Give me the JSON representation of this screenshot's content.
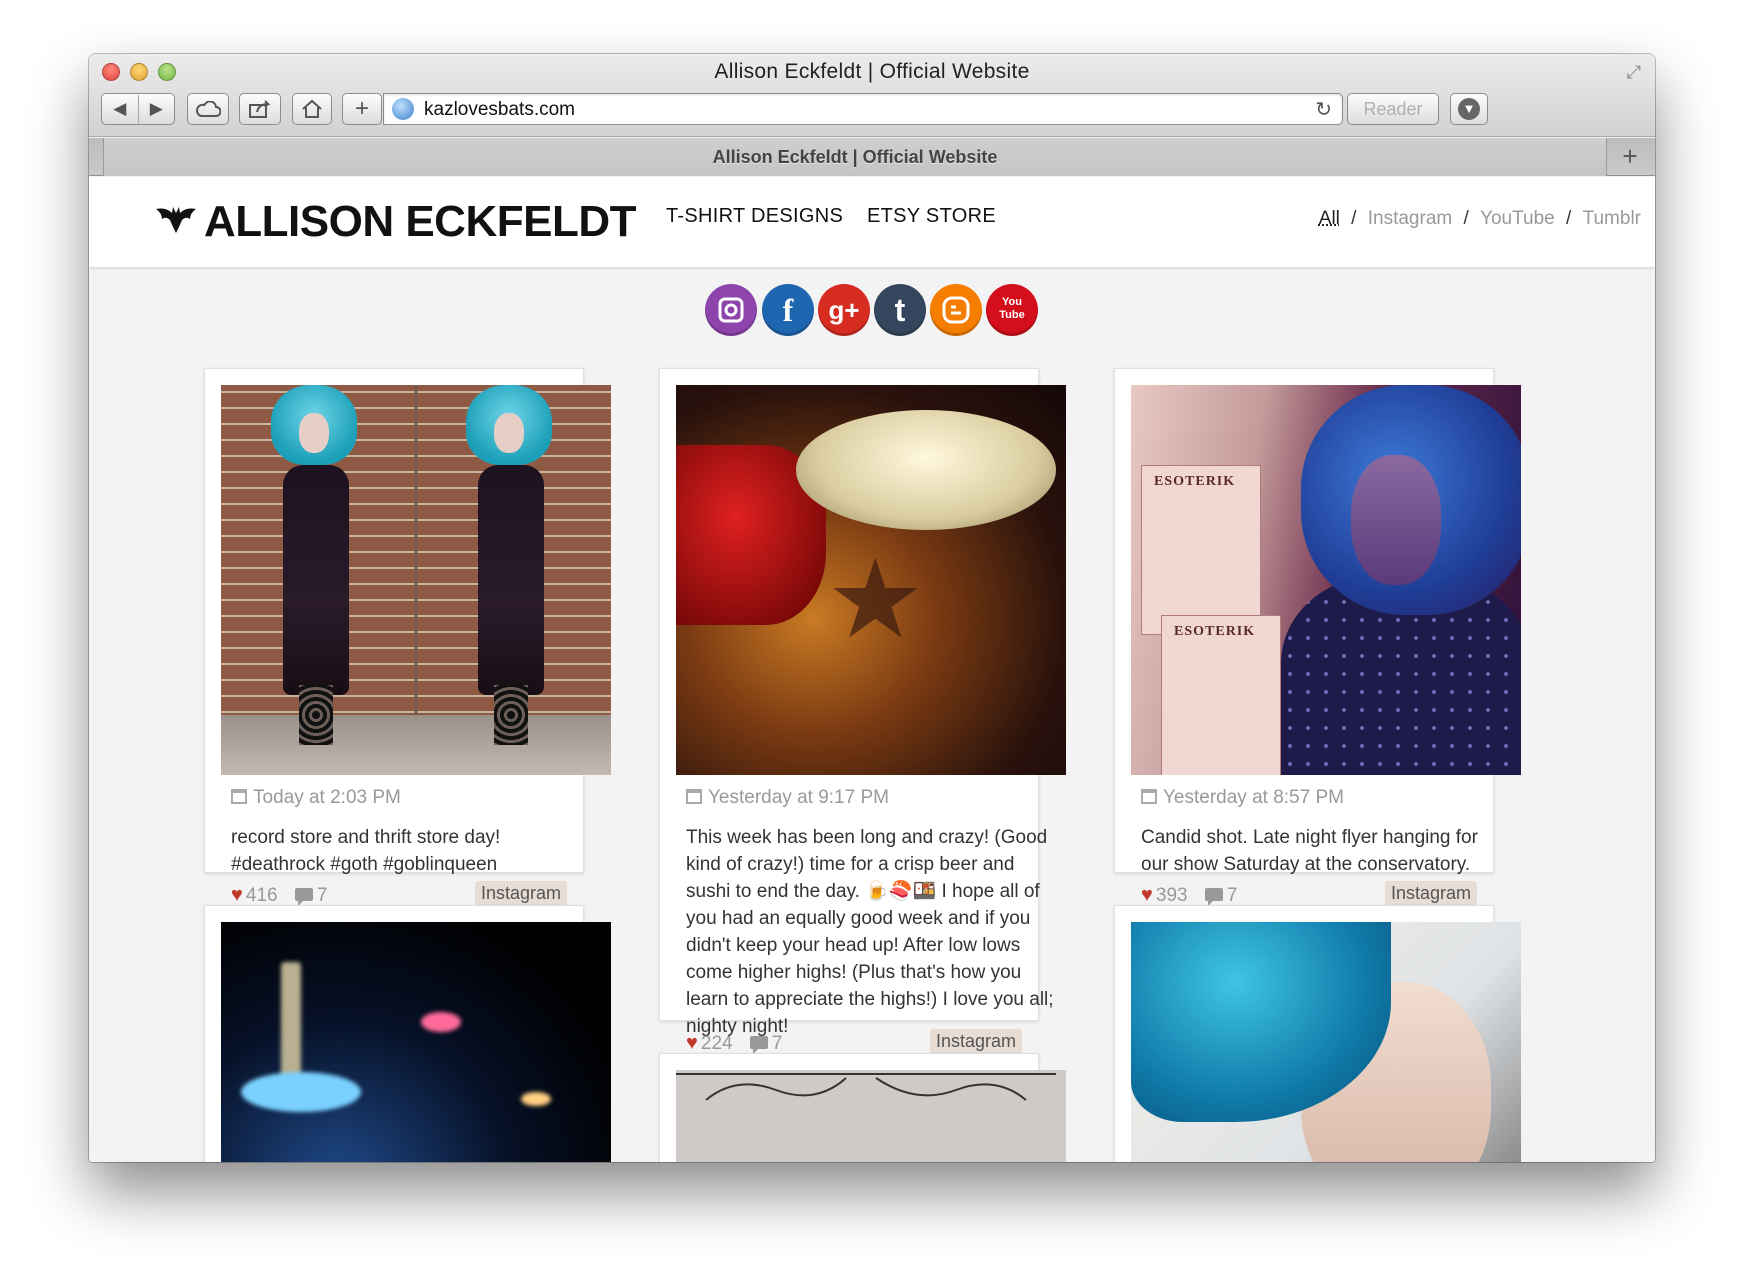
{
  "browser": {
    "window_title": "Allison Eckfeldt | Official Website",
    "url": "kazlovesbats.com",
    "reader_label": "Reader",
    "tab_title": "Allison Eckfeldt | Official Website",
    "new_tab_label": "+",
    "add_button_label": "+",
    "back_glyph": "◀",
    "forward_glyph": "▶"
  },
  "site": {
    "title": "ALLISON ECKFELDT",
    "nav": [
      "T-SHIRT DESIGNS",
      "ETSY STORE"
    ],
    "filters": {
      "items": [
        "All",
        "Instagram",
        "YouTube",
        "Tumblr"
      ],
      "separator": "/",
      "active": "All"
    },
    "social_icons": [
      "instagram-icon",
      "facebook-icon",
      "google-plus-icon",
      "tumblr-icon",
      "blogger-icon",
      "youtube-icon"
    ],
    "social_glyphs": {
      "facebook": "f",
      "google_plus": "g+",
      "tumblr": "t",
      "youtube": "You\nTube"
    }
  },
  "posts": [
    {
      "date": "Today at 2:03 PM",
      "text": "record store and thrift store day! #deathrock #goth #goblinqueen",
      "likes": "416",
      "comments": "7",
      "source": "Instagram"
    },
    {
      "date": "Yesterday at 9:17 PM",
      "text": "This week has been long and crazy! (Good kind of crazy!) time for a crisp beer and sushi to end the day. 🍺🍣🍱 I hope all of you had an equally good week and if you didn't keep your head up! After low lows come higher highs! (Plus that's how you learn to appreciate the highs!) I love you all; nighty night!",
      "likes": "224",
      "comments": "7",
      "source": "Instagram"
    },
    {
      "date": "Yesterday at 8:57 PM",
      "text": "Candid shot. Late night flyer hanging for our show Saturday at the conservatory.",
      "likes": "393",
      "comments": "7",
      "source": "Instagram",
      "flyer_text": "ESOTERIK"
    }
  ],
  "colors": {
    "instagram": "#8e44ad",
    "facebook": "#1f66b1",
    "google_plus": "#d62d20",
    "tumblr": "#34465d",
    "blogger": "#f57d00",
    "youtube": "#d40e1a",
    "tag_bg": "#e8ddd5",
    "heart": "#c0392b"
  }
}
